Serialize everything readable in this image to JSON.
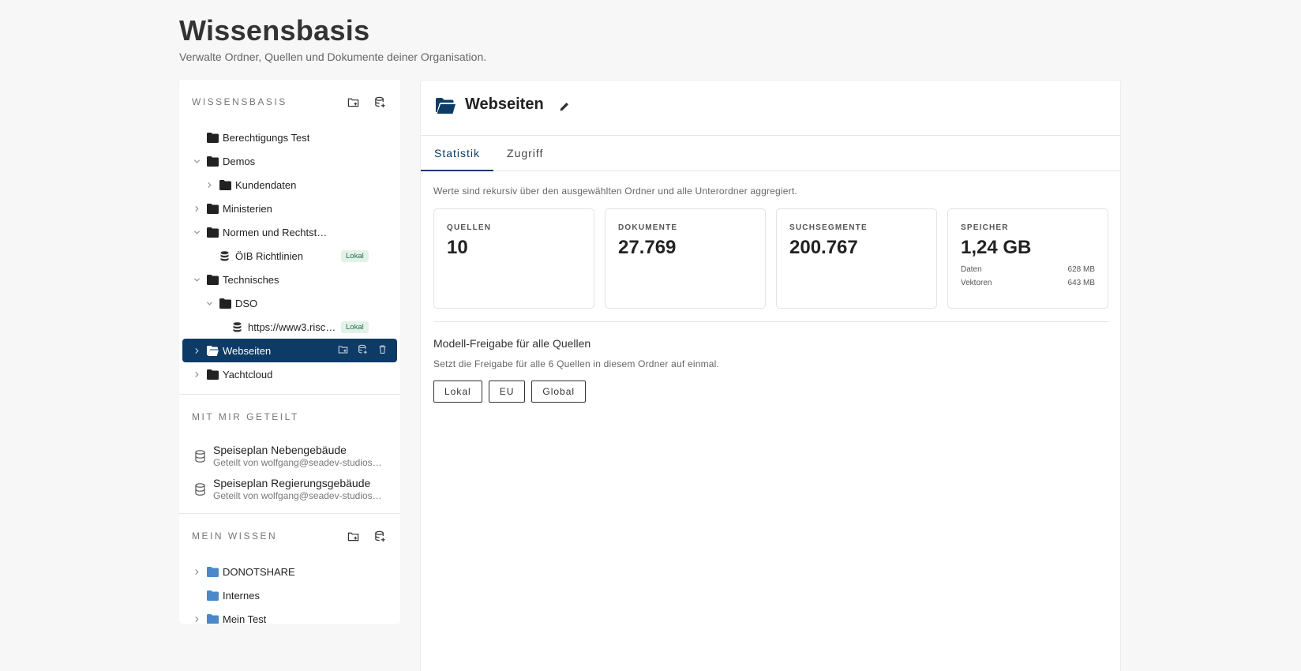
{
  "page": {
    "title": "Wissensbasis",
    "subtitle": "Verwalte Ordner, Quellen und Dokumente deiner Organisation."
  },
  "sidebar": {
    "org_section_title": "WISSENSBASIS",
    "org_tree": [
      {
        "label": "Berechtigungs Test",
        "type": "folder",
        "level": 0,
        "chevron": "none"
      },
      {
        "label": "Demos",
        "type": "folder",
        "level": 0,
        "chevron": "down"
      },
      {
        "label": "Kundendaten",
        "type": "folder",
        "level": 1,
        "chevron": "right"
      },
      {
        "label": "Ministerien",
        "type": "folder",
        "level": 0,
        "chevron": "right"
      },
      {
        "label": "Normen und Rechtst…",
        "type": "folder",
        "level": 0,
        "chevron": "down"
      },
      {
        "label": "ÖIB Richtlinien",
        "type": "source",
        "level": 1,
        "chevron": "none",
        "badge": "Lokal"
      },
      {
        "label": "Technisches",
        "type": "folder",
        "level": 0,
        "chevron": "down"
      },
      {
        "label": "DSO",
        "type": "folder",
        "level": 1,
        "chevron": "down"
      },
      {
        "label": "https://www3.risc…",
        "type": "source",
        "level": 2,
        "chevron": "none",
        "badge": "Lokal"
      },
      {
        "label": "Webseiten",
        "type": "folder-open",
        "level": 0,
        "chevron": "right",
        "selected": true
      },
      {
        "label": "Yachtcloud",
        "type": "folder",
        "level": 0,
        "chevron": "right"
      }
    ],
    "shared_section_title": "MIT MIR GETEILT",
    "shared_items": [
      {
        "title": "Speiseplan Nebengebäude",
        "subtitle": "Geteilt von wolfgang@seadev-studios.com"
      },
      {
        "title": "Speiseplan Regierungsgebäude",
        "subtitle": "Geteilt von wolfgang@seadev-studios.com"
      }
    ],
    "mine_section_title": "MEIN WISSEN",
    "mine_tree": [
      {
        "label": "DONOTSHARE",
        "type": "folder-light",
        "level": 0,
        "chevron": "right"
      },
      {
        "label": "Internes",
        "type": "folder-light",
        "level": 0,
        "chevron": "none"
      },
      {
        "label": "Mein Test",
        "type": "folder-light",
        "level": 0,
        "chevron": "right"
      }
    ]
  },
  "main": {
    "title": "Webseiten",
    "tabs": [
      {
        "label": "Statistik",
        "active": true
      },
      {
        "label": "Zugriff",
        "active": false
      }
    ],
    "note": "Werte sind rekursiv über den ausgewählten Ordner und alle Unterordner aggregiert.",
    "stats": [
      {
        "label": "QUELLEN",
        "value": "10"
      },
      {
        "label": "DOKUMENTE",
        "value": "27.769"
      },
      {
        "label": "SUCHSEGMENTE",
        "value": "200.767"
      },
      {
        "label": "SPEICHER",
        "value": "1,24 GB",
        "rows": [
          {
            "label": "Daten",
            "value": "628 MB"
          },
          {
            "label": "Vektoren",
            "value": "643 MB"
          }
        ]
      }
    ],
    "release": {
      "title": "Modell-Freigabe für alle Quellen",
      "subtitle": "Setzt die Freigabe für alle 6 Quellen in diesem Ordner auf einmal.",
      "buttons": [
        "Lokal",
        "EU",
        "Global"
      ]
    }
  },
  "colors": {
    "accent": "#0d3b66",
    "folder_dark": "#222222",
    "folder_light": "#4a88c7",
    "badge_bg": "#e2f2e8",
    "badge_text": "#2c6a4a"
  }
}
